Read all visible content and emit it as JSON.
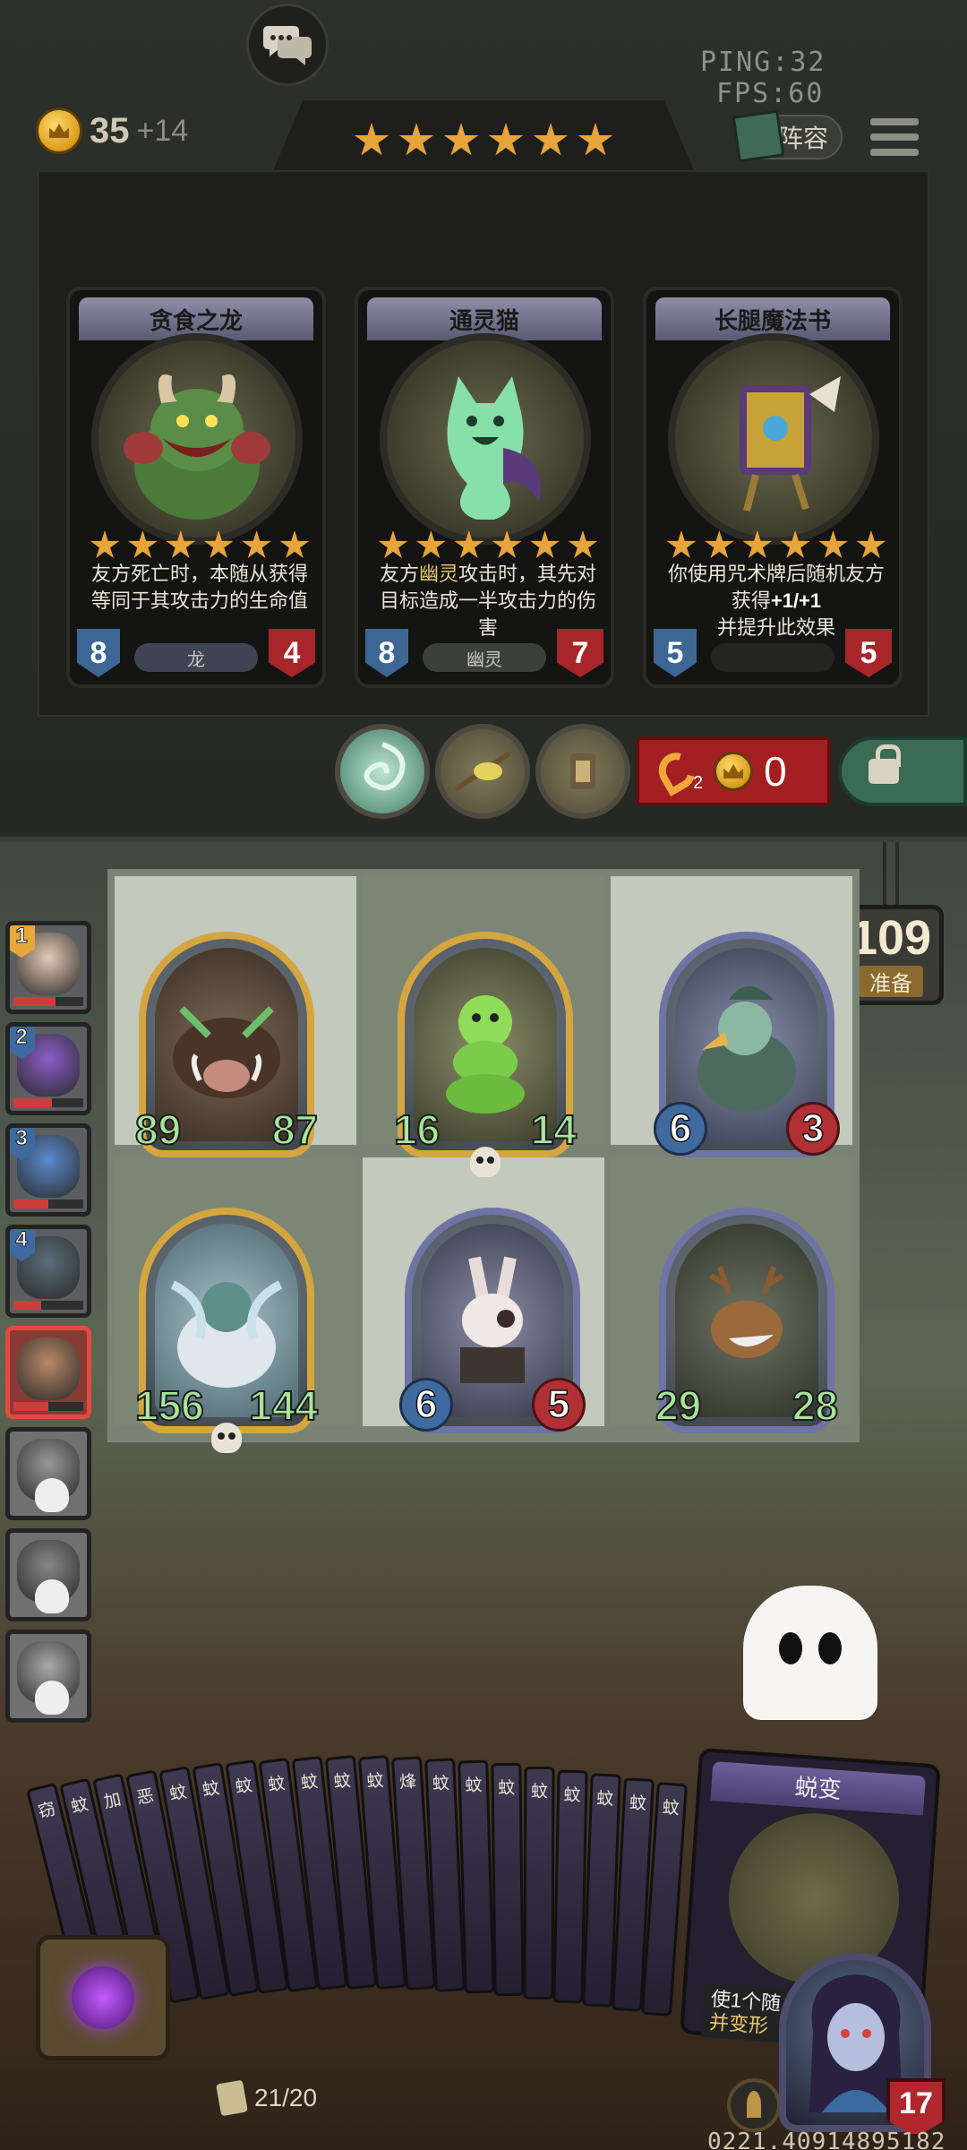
{
  "hud": {
    "ping_label": "PING:",
    "ping": "32",
    "fps_label": "FPS:",
    "fps": "60",
    "gold": "35",
    "gold_income": "+14",
    "tavern_tier_stars": 6,
    "lineup_label": "阵容"
  },
  "shop": {
    "cards": [
      {
        "name": "贪食之龙",
        "desc_parts": [
          "友方死亡时，本随从获得等同于其攻击力的生命值"
        ],
        "attack": "8",
        "health": "4",
        "tribe": "龙"
      },
      {
        "name": "通灵猫",
        "desc_pre": "友方",
        "desc_key": "幽灵",
        "desc_post": "攻击时，其先对目标造成一半攻击力的伤害",
        "attack": "8",
        "health": "7",
        "tribe": "幽灵"
      },
      {
        "name": "长腿魔法书",
        "desc_pre": "你使用咒术牌后随机友方获得",
        "desc_bold": "+1/+1",
        "desc_post": "并提升此效果",
        "attack": "5",
        "health": "5",
        "tribe": ""
      }
    ],
    "refresh_count": "2",
    "refresh_cost": "0"
  },
  "board": {
    "timer": "109",
    "timer_label": "准备",
    "minions": [
      {
        "attack": "89",
        "health": "87",
        "frame": "gold"
      },
      {
        "attack": "16",
        "health": "14",
        "frame": "gold",
        "deathrattle": true
      },
      {
        "attack": "6",
        "health": "3",
        "frame": "blue"
      },
      {
        "attack": "156",
        "health": "144",
        "frame": "gold",
        "deathrattle": true
      },
      {
        "attack": "6",
        "health": "5",
        "frame": "blue"
      },
      {
        "attack": "29",
        "health": "28",
        "frame": "blue"
      }
    ]
  },
  "roster": [
    {
      "rank": "1",
      "state": "alive",
      "hp_frac": 0.6
    },
    {
      "rank": "2",
      "state": "alive",
      "hp_frac": 0.55
    },
    {
      "rank": "3",
      "state": "alive",
      "hp_frac": 0.5
    },
    {
      "rank": "4",
      "state": "alive",
      "hp_frac": 0.4
    },
    {
      "rank": "",
      "state": "current",
      "hp_frac": 0.5
    },
    {
      "rank": "",
      "state": "dead",
      "hp_frac": 0
    },
    {
      "rank": "",
      "state": "dead",
      "hp_frac": 0
    },
    {
      "rank": "",
      "state": "dead",
      "hp_frac": 0
    }
  ],
  "hand": {
    "card_initials": [
      "窃",
      "蚊",
      "加",
      "恶",
      "蚊",
      "蚊",
      "蚊",
      "蚊",
      "蚊",
      "蚊",
      "蚊",
      "烽",
      "蚊",
      "蚊",
      "蚊",
      "蚊",
      "蚊",
      "蚊",
      "蚊",
      "蚊"
    ],
    "featured_card": {
      "title": "蜕变",
      "desc_pre": "使1个随",
      "desc_key": "并变形",
      "desc_post": ""
    },
    "count": "21/20"
  },
  "player": {
    "health": "17"
  },
  "build_id": "0221.40914895182",
  "colors": {
    "gold": "#e6a43b",
    "health_red": "#a8262a",
    "attack_blue": "#3e6694",
    "buffed_green": "#a7e59c"
  }
}
